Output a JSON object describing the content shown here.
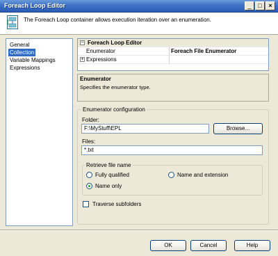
{
  "window": {
    "title": "Foreach Loop Editor",
    "controls": [
      "_",
      "□",
      "×"
    ]
  },
  "header": {
    "description": "The Foreach Loop container allows execution iteration over an enumeration."
  },
  "nav": {
    "items": [
      {
        "label": "General",
        "selected": false
      },
      {
        "label": "Collection",
        "selected": true
      },
      {
        "label": "Variable Mappings",
        "selected": false
      },
      {
        "label": "Expressions",
        "selected": false
      }
    ]
  },
  "property_grid": {
    "category": "Foreach Loop Editor",
    "category_expander": "⊟",
    "rows": [
      {
        "name": "Enumerator",
        "value": "Foreach File Enumerator"
      },
      {
        "name": "Expressions",
        "value": "",
        "expander": "⊞"
      }
    ]
  },
  "description_box": {
    "title": "Enumerator",
    "text": "Specifies the enumerator type."
  },
  "enumerator_config": {
    "title": "Enumerator configuration",
    "folder_label": "Folder:",
    "folder_value": "F:\\MyStuff\\EPL",
    "browse_label": "Browse...",
    "files_label": "Files:",
    "files_value": "*.txt",
    "retrieve_title": "Retrieve file name",
    "radios": [
      {
        "label": "Fully qualified",
        "checked": false
      },
      {
        "label": "Name and extension",
        "checked": false
      },
      {
        "label": "Name only",
        "checked": true
      }
    ],
    "traverse_label": "Traverse subfolders",
    "traverse_checked": false
  },
  "footer": {
    "ok_label": "OK",
    "cancel_label": "Cancel",
    "help_label": "Help"
  }
}
